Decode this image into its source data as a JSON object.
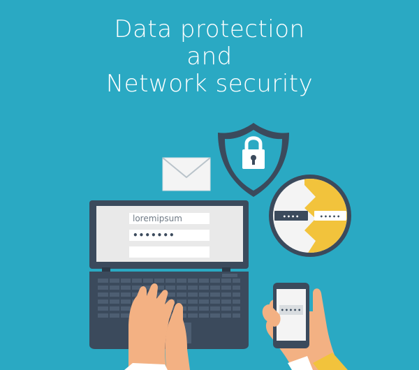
{
  "title": {
    "line1": "Data protection",
    "line2": "and",
    "line3": "Network security"
  },
  "laptop": {
    "username_value": "loremipsum",
    "password_value": "•••••••",
    "third_field_value": ""
  },
  "key_exchange": {
    "left_code": "••••",
    "right_code": "•••••"
  },
  "phone": {
    "screen_code": "•••••"
  },
  "colors": {
    "background": "#2aa9c3",
    "dark": "#3b4a5c",
    "accent_yellow": "#f2c33c",
    "paper": "#f4f4f4"
  },
  "icons": [
    "envelope-icon",
    "shield-lock-icon",
    "padlock-icon"
  ]
}
